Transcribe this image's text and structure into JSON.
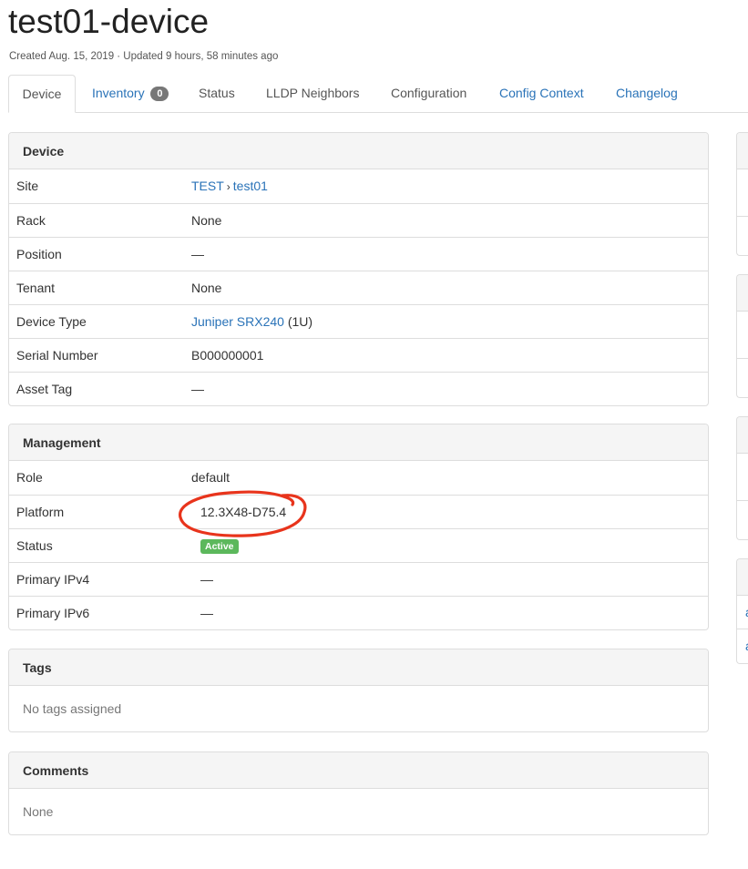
{
  "page": {
    "title": "test01-device",
    "subtitle": "Created Aug. 15, 2019 · Updated 9 hours, 58 minutes ago"
  },
  "tabs": [
    {
      "label": "Device",
      "active": true
    },
    {
      "label": "Inventory",
      "badge": "0"
    },
    {
      "label": "Status"
    },
    {
      "label": "LLDP Neighbors"
    },
    {
      "label": "Configuration"
    },
    {
      "label": "Config Context"
    },
    {
      "label": "Changelog"
    }
  ],
  "device_panel": {
    "heading": "Device",
    "site_label": "Site",
    "site_parent": "TEST",
    "site_separator": "›",
    "site_name": "test01",
    "rack_label": "Rack",
    "rack_value": "None",
    "position_label": "Position",
    "position_value": "—",
    "tenant_label": "Tenant",
    "tenant_value": "None",
    "device_type_label": "Device Type",
    "device_type_link": "Juniper SRX240",
    "device_type_suffix": "(1U)",
    "serial_label": "Serial Number",
    "serial_value": "B000000001",
    "asset_tag_label": "Asset Tag",
    "asset_tag_value": "—"
  },
  "management_panel": {
    "heading": "Management",
    "role_label": "Role",
    "role_value": "default",
    "platform_label": "Platform",
    "platform_value": "12.3X48-D75.4",
    "status_label": "Status",
    "status_value": "Active",
    "ipv4_label": "Primary IPv4",
    "ipv4_value": "—",
    "ipv6_label": "Primary IPv6",
    "ipv6_value": "—"
  },
  "tags_panel": {
    "heading": "Tags",
    "body": "No tags assigned"
  },
  "comments_panel": {
    "heading": "Comments",
    "body": "None"
  },
  "side_panels": {
    "link_row_1": "a",
    "link_row_2": "a"
  },
  "colors": {
    "link": "#2a73b8",
    "status_active": "#5cb85c",
    "annotation_circle": "#e8341c"
  }
}
